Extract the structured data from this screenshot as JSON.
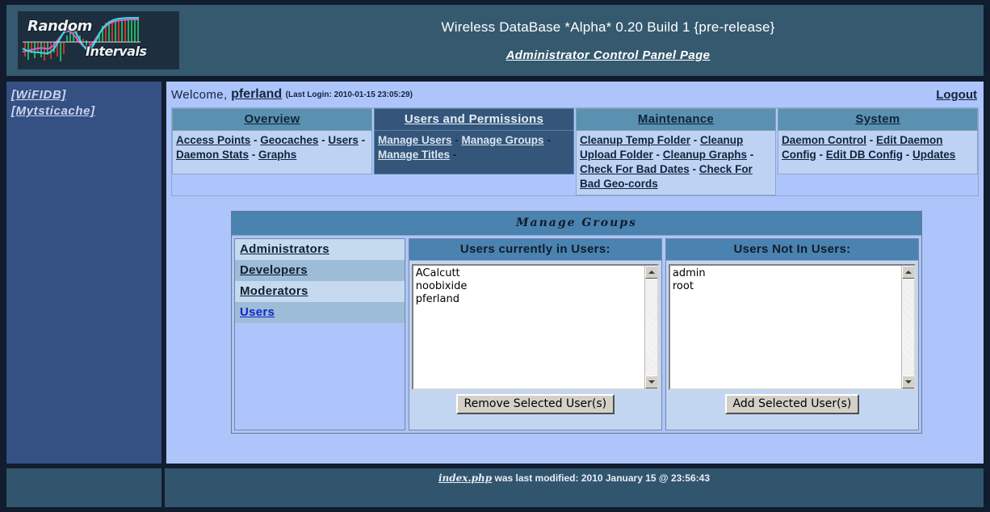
{
  "header": {
    "logo_word_1": "Random",
    "logo_word_2": "Intervals",
    "app_title": "Wireless DataBase *Alpha* 0.20 Build 1 {pre-release}",
    "page_subtitle": "Administrator Control Panel Page"
  },
  "sidebar": {
    "links": [
      {
        "label": "[WiFIDB]"
      },
      {
        "label": "[Mytsticache]"
      }
    ]
  },
  "welcome": {
    "greeting": "Welcome,",
    "username": "pferland",
    "last_login": "(Last Login: 2010-01-15 23:05:29)",
    "logout_label": "Logout"
  },
  "tabs": [
    {
      "title": "Overview",
      "active": false,
      "links": [
        "Access Points",
        "Geocaches",
        "Users",
        "Daemon Stats",
        "Graphs"
      ],
      "trailing_sep": false
    },
    {
      "title": "Users and Permissions",
      "active": true,
      "links": [
        "Manage Users",
        "Manage Groups",
        "Manage Titles"
      ],
      "trailing_sep": true
    },
    {
      "title": "Maintenance",
      "active": false,
      "links": [
        "Cleanup Temp Folder",
        "Cleanup Upload Folder",
        "Cleanup Graphs",
        "Check For Bad Dates",
        "Check For Bad Geo-cords"
      ],
      "trailing_sep": false
    },
    {
      "title": "System",
      "active": false,
      "links": [
        "Daemon Control",
        "Edit Daemon Config",
        "Edit DB Config",
        "Updates"
      ],
      "trailing_sep": false
    }
  ],
  "panel": {
    "title": "Manage  Groups",
    "groups": [
      {
        "label": "Administrators",
        "selected": false
      },
      {
        "label": "Developers",
        "selected": false
      },
      {
        "label": "Moderators",
        "selected": false
      },
      {
        "label": "Users",
        "selected": true
      }
    ],
    "members": {
      "header": "Users currently in Users:",
      "items": [
        "ACalcutt",
        "noobixide",
        "pferland"
      ],
      "button_label": "Remove Selected User(s)"
    },
    "non_members": {
      "header": "Users Not In Users:",
      "items": [
        "admin",
        "root"
      ],
      "button_label": "Add Selected User(s)"
    }
  },
  "footer": {
    "filename": "index.php",
    "text": " was last modified: 2010 January 15 @ 23:56:43"
  },
  "colors": {
    "page_background": "#111c2e",
    "header_background": "#35596f",
    "sidebar_background": "#355083",
    "content_background": "#aec5fc",
    "tab_header": "#5a91b0",
    "tab_active": "#33567a",
    "panel_header": "#4a82b0",
    "footer_background": "#32556e"
  }
}
